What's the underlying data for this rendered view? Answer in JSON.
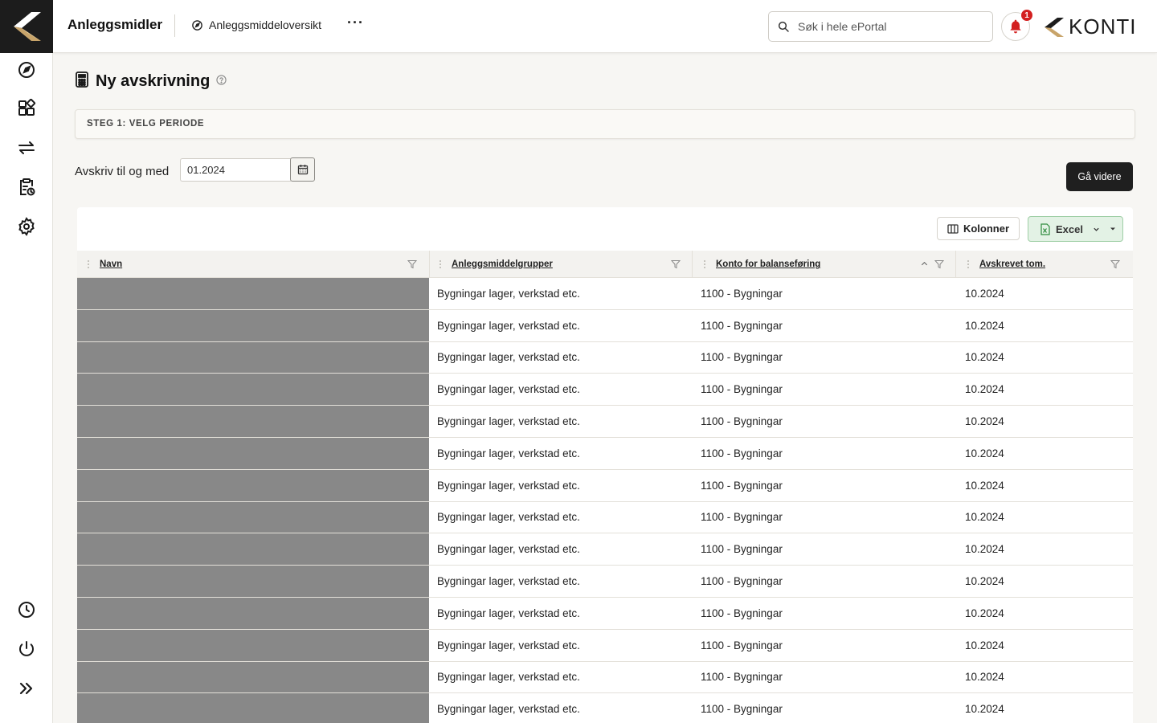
{
  "header": {
    "app_title": "Anleggsmidler",
    "breadcrumb": "Anleggsmiddeloversikt",
    "more": "···",
    "search_placeholder": "Søk i hele ePortal",
    "notification_count": "1",
    "brand": "KONTI"
  },
  "sidebar": {
    "items": [
      {
        "icon": "dashboard-icon"
      },
      {
        "icon": "assets-icon"
      },
      {
        "icon": "transfer-icon"
      },
      {
        "icon": "clipboard-clock-icon"
      },
      {
        "icon": "gear-icon"
      }
    ],
    "bottom": [
      {
        "icon": "clock-icon"
      },
      {
        "icon": "power-icon"
      },
      {
        "icon": "expand-icon"
      }
    ]
  },
  "page": {
    "title": "Ny avskrivning",
    "step_label": "STEG 1: VELG PERIODE",
    "period_label": "Avskriv til og med",
    "period_value": "01.2024",
    "go_button": "Gå videre"
  },
  "toolbar": {
    "columns_label": "Kolonner",
    "excel_label": "Excel"
  },
  "table": {
    "columns": [
      "Navn",
      "Anleggsmiddelgrupper",
      "Konto for balanseføring",
      "Avskrevet tom."
    ],
    "rows": [
      {
        "navn": "",
        "gruppe": "Bygningar lager, verkstad etc.",
        "konto": "1100 - Bygningar",
        "avskrevet": "10.2024"
      },
      {
        "navn": "",
        "gruppe": "Bygningar lager, verkstad etc.",
        "konto": "1100 - Bygningar",
        "avskrevet": "10.2024"
      },
      {
        "navn": "",
        "gruppe": "Bygningar lager, verkstad etc.",
        "konto": "1100 - Bygningar",
        "avskrevet": "10.2024"
      },
      {
        "navn": "",
        "gruppe": "Bygningar lager, verkstad etc.",
        "konto": "1100 - Bygningar",
        "avskrevet": "10.2024"
      },
      {
        "navn": "",
        "gruppe": "Bygningar lager, verkstad etc.",
        "konto": "1100 - Bygningar",
        "avskrevet": "10.2024"
      },
      {
        "navn": "",
        "gruppe": "Bygningar lager, verkstad etc.",
        "konto": "1100 - Bygningar",
        "avskrevet": "10.2024"
      },
      {
        "navn": "",
        "gruppe": "Bygningar lager, verkstad etc.",
        "konto": "1100 - Bygningar",
        "avskrevet": "10.2024"
      },
      {
        "navn": "",
        "gruppe": "Bygningar lager, verkstad etc.",
        "konto": "1100 - Bygningar",
        "avskrevet": "10.2024"
      },
      {
        "navn": "",
        "gruppe": "Bygningar lager, verkstad etc.",
        "konto": "1100 - Bygningar",
        "avskrevet": "10.2024"
      },
      {
        "navn": "",
        "gruppe": "Bygningar lager, verkstad etc.",
        "konto": "1100 - Bygningar",
        "avskrevet": "10.2024"
      },
      {
        "navn": "",
        "gruppe": "Bygningar lager, verkstad etc.",
        "konto": "1100 - Bygningar",
        "avskrevet": "10.2024"
      },
      {
        "navn": "",
        "gruppe": "Bygningar lager, verkstad etc.",
        "konto": "1100 - Bygningar",
        "avskrevet": "10.2024"
      },
      {
        "navn": "",
        "gruppe": "Bygningar lager, verkstad etc.",
        "konto": "1100 - Bygningar",
        "avskrevet": "10.2024"
      },
      {
        "navn": "",
        "gruppe": "Bygningar lager, verkstad etc.",
        "konto": "1100 - Bygningar",
        "avskrevet": "10.2024"
      }
    ]
  },
  "colors": {
    "accent_dark": "#1c1c1c",
    "gold": "#c8a46a",
    "excel_bg": "#e3f2e5",
    "badge": "#d32020",
    "redacted": "#888888"
  }
}
